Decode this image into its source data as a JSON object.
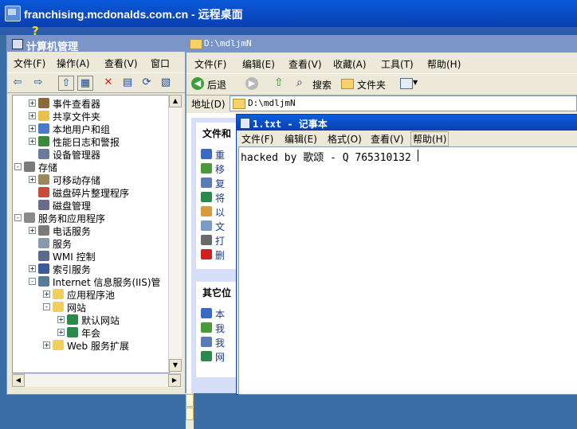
{
  "rdp": {
    "title": "franchising.mcdonalds.com.cn - 远程桌面",
    "help_mark": "?"
  },
  "cm": {
    "title": "计算机管理",
    "menu": [
      "文件(F)",
      "操作(A)",
      "查看(V)",
      "窗口"
    ],
    "tree": [
      {
        "label": "事件查看器",
        "indent": 1,
        "exp": "+",
        "icon": "event-viewer-icon",
        "color": "#8a6a3a"
      },
      {
        "label": "共享文件夹",
        "indent": 1,
        "exp": "+",
        "icon": "shared-folder-icon",
        "color": "#e8c04a"
      },
      {
        "label": "本地用户和组",
        "indent": 1,
        "exp": "+",
        "icon": "users-icon",
        "color": "#4a7ac8"
      },
      {
        "label": "性能日志和警报",
        "indent": 1,
        "exp": "+",
        "icon": "performance-icon",
        "color": "#3a8a3a"
      },
      {
        "label": "设备管理器",
        "indent": 1,
        "exp": "",
        "icon": "device-manager-icon",
        "color": "#6a7a9a"
      },
      {
        "label": "存储",
        "indent": 0,
        "exp": "-",
        "icon": "storage-icon",
        "color": "#7a7a7a"
      },
      {
        "label": "可移动存储",
        "indent": 1,
        "exp": "+",
        "icon": "removable-storage-icon",
        "color": "#9a8a5a"
      },
      {
        "label": "磁盘碎片整理程序",
        "indent": 1,
        "exp": "",
        "icon": "defrag-icon",
        "color": "#c84a3a"
      },
      {
        "label": "磁盘管理",
        "indent": 1,
        "exp": "",
        "icon": "disk-management-icon",
        "color": "#6a6a8a"
      },
      {
        "label": "服务和应用程序",
        "indent": 0,
        "exp": "-",
        "icon": "services-apps-icon",
        "color": "#8a8a8a"
      },
      {
        "label": "电话服务",
        "indent": 1,
        "exp": "+",
        "icon": "telephony-icon",
        "color": "#7a7a7a"
      },
      {
        "label": "服务",
        "indent": 1,
        "exp": "",
        "icon": "services-icon",
        "color": "#8a9aaa"
      },
      {
        "label": "WMI 控制",
        "indent": 1,
        "exp": "",
        "icon": "wmi-icon",
        "color": "#5a6a8a"
      },
      {
        "label": "索引服务",
        "indent": 1,
        "exp": "+",
        "icon": "indexing-icon",
        "color": "#3a5a9a"
      },
      {
        "label": "Internet 信息服务(IIS)管",
        "indent": 1,
        "exp": "-",
        "icon": "iis-icon",
        "color": "#5a7a9a"
      },
      {
        "label": "应用程序池",
        "indent": 2,
        "exp": "+",
        "icon": "folder-icon",
        "color": "#f0cf5a"
      },
      {
        "label": "网站",
        "indent": 2,
        "exp": "-",
        "icon": "folder-icon",
        "color": "#f0cf5a"
      },
      {
        "label": "默认网站",
        "indent": 3,
        "exp": "+",
        "icon": "website-icon",
        "color": "#2a8a4a"
      },
      {
        "label": "年会",
        "indent": 3,
        "exp": "+",
        "icon": "website-icon",
        "color": "#2a8a4a"
      },
      {
        "label": "Web 服务扩展",
        "indent": 2,
        "exp": "+",
        "icon": "folder-icon",
        "color": "#f0cf5a"
      }
    ]
  },
  "ex": {
    "title": "D:\\mdljmN",
    "menu": [
      "文件(F)",
      "编辑(E)",
      "查看(V)",
      "收藏(A)",
      "工具(T)",
      "帮助(H)"
    ],
    "back_label": "后退",
    "search_label": "搜索",
    "folders_label": "文件夹",
    "addr_label": "地址(D)",
    "addr_value": "D:\\mdljmN",
    "panel1_head": "文件和",
    "panel1_tasks": [
      "重",
      "移",
      "复",
      "将",
      "以",
      "文",
      "打",
      "删"
    ],
    "panel2_head": "其它位",
    "panel2_tasks": [
      "本",
      "我",
      "我",
      "网"
    ]
  },
  "np": {
    "title": "1.txt - 记事本",
    "menu": [
      "文件(F)",
      "编辑(E)",
      "格式(O)",
      "查看(V)",
      "帮助(H)"
    ],
    "text": "hacked by 歌颂 - Q 765310132"
  }
}
